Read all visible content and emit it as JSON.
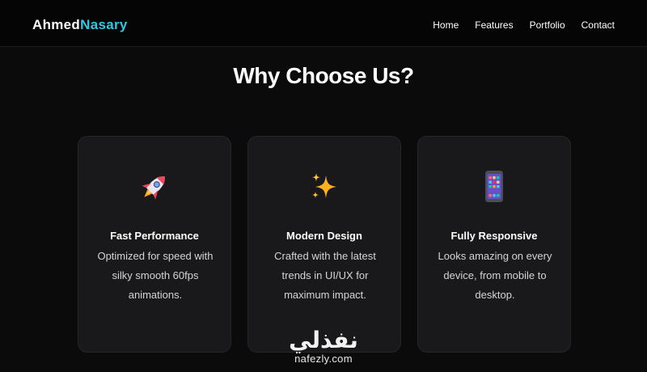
{
  "brand": {
    "first": "Ahmed",
    "second": "Nasary",
    "accent_color": "#2ec8e6"
  },
  "nav": {
    "items": [
      "Home",
      "Features",
      "Portfolio",
      "Contact"
    ]
  },
  "section": {
    "title": "Why Choose Us?"
  },
  "features": [
    {
      "icon": "rocket-icon",
      "title": "Fast Performance",
      "lines": [
        "Optimized for speed with",
        "silky smooth 60fps",
        "animations."
      ]
    },
    {
      "icon": "sparkles-icon",
      "title": "Modern Design",
      "lines": [
        "Crafted with the latest",
        "trends in UI/UX for",
        "maximum impact."
      ]
    },
    {
      "icon": "mobile-phone-icon",
      "title": "Fully Responsive",
      "lines": [
        "Looks amazing on every",
        "device, from mobile to",
        "desktop."
      ]
    }
  ],
  "watermark": {
    "arabic": "نفذلي",
    "latin": "nafezly.com"
  }
}
